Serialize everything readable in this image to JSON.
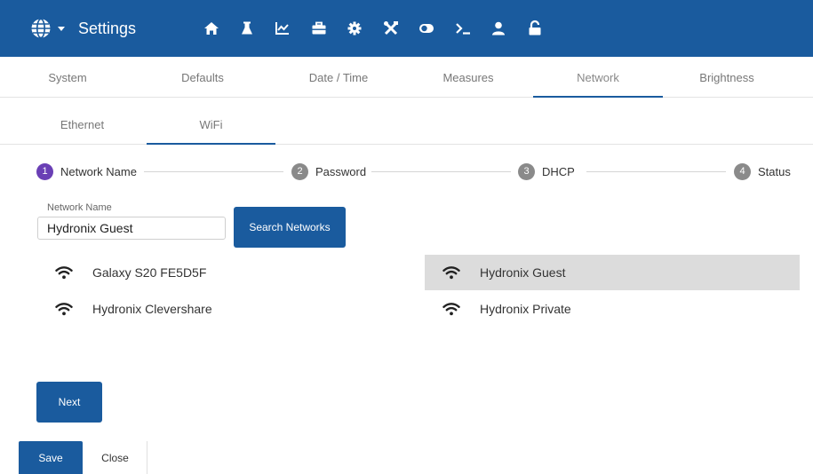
{
  "header": {
    "title": "Settings",
    "accent_color": "#1a5b9e",
    "left_icons": [
      "globe-icon",
      "caret-down-icon"
    ],
    "nav_icons": [
      "home-icon",
      "flask-icon",
      "chart-icon",
      "briefcase-icon",
      "gear-icon",
      "tools-icon",
      "toggle-icon",
      "terminal-icon",
      "user-icon",
      "unlock-icon"
    ]
  },
  "tabs": [
    {
      "label": "System"
    },
    {
      "label": "Defaults"
    },
    {
      "label": "Date / Time"
    },
    {
      "label": "Measures"
    },
    {
      "label": "Network",
      "active": true
    },
    {
      "label": "Brightness"
    }
  ],
  "subtabs": [
    {
      "label": "Ethernet"
    },
    {
      "label": "WiFi",
      "active": true
    }
  ],
  "stepper": [
    {
      "num": "1",
      "label": "Network Name",
      "active": true
    },
    {
      "num": "2",
      "label": "Password"
    },
    {
      "num": "3",
      "label": "DHCP"
    },
    {
      "num": "4",
      "label": "Status"
    }
  ],
  "network_name": {
    "label": "Network Name",
    "value": "Hydronix Guest"
  },
  "search_button": "Search Networks",
  "networks": [
    {
      "name": "Galaxy S20 FE5D5F",
      "icon": "wifi-icon"
    },
    {
      "name": "Hydronix Guest",
      "icon": "wifi-icon",
      "selected": true
    },
    {
      "name": "Hydronix Clevershare",
      "icon": "wifi-icon"
    },
    {
      "name": "Hydronix Private",
      "icon": "wifi-icon"
    }
  ],
  "next_button": "Next",
  "footer": {
    "save": "Save",
    "close": "Close"
  }
}
